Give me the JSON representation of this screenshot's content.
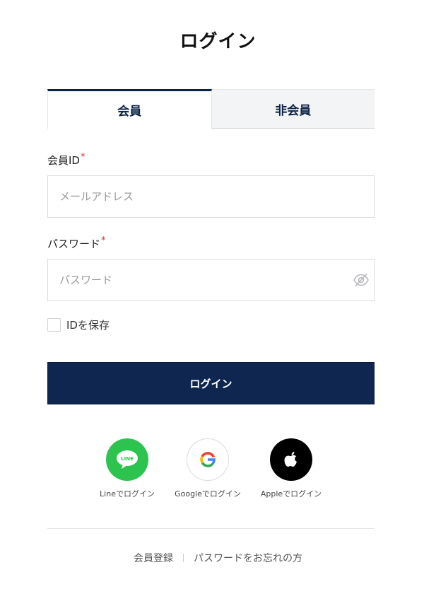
{
  "page": {
    "title": "ログイン"
  },
  "tabs": [
    {
      "label": "会員",
      "active": true
    },
    {
      "label": "非会員",
      "active": false
    }
  ],
  "member_id": {
    "label": "会員ID",
    "required_mark": "*",
    "placeholder": "メールアドレス",
    "value": ""
  },
  "password": {
    "label": "パスワード",
    "required_mark": "*",
    "placeholder": "パスワード",
    "value": "",
    "toggle_icon": "eye-off-icon"
  },
  "save_id": {
    "label": "IDを保存",
    "checked": false
  },
  "login_button": {
    "label": "ログイン"
  },
  "social": [
    {
      "caption": "Lineでログイン",
      "icon": "line-icon",
      "icon_text": "LINE",
      "color": "#2cc44f"
    },
    {
      "caption": "Googleでログイン",
      "icon": "google-icon",
      "color": "#ffffff"
    },
    {
      "caption": "Appleでログイン",
      "icon": "apple-icon",
      "color": "#000000"
    }
  ],
  "footer": {
    "register": "会員登録",
    "forgot": "パスワードをお忘れの方"
  },
  "colors": {
    "navy": "#0f2650",
    "required": "#d32f2f"
  }
}
